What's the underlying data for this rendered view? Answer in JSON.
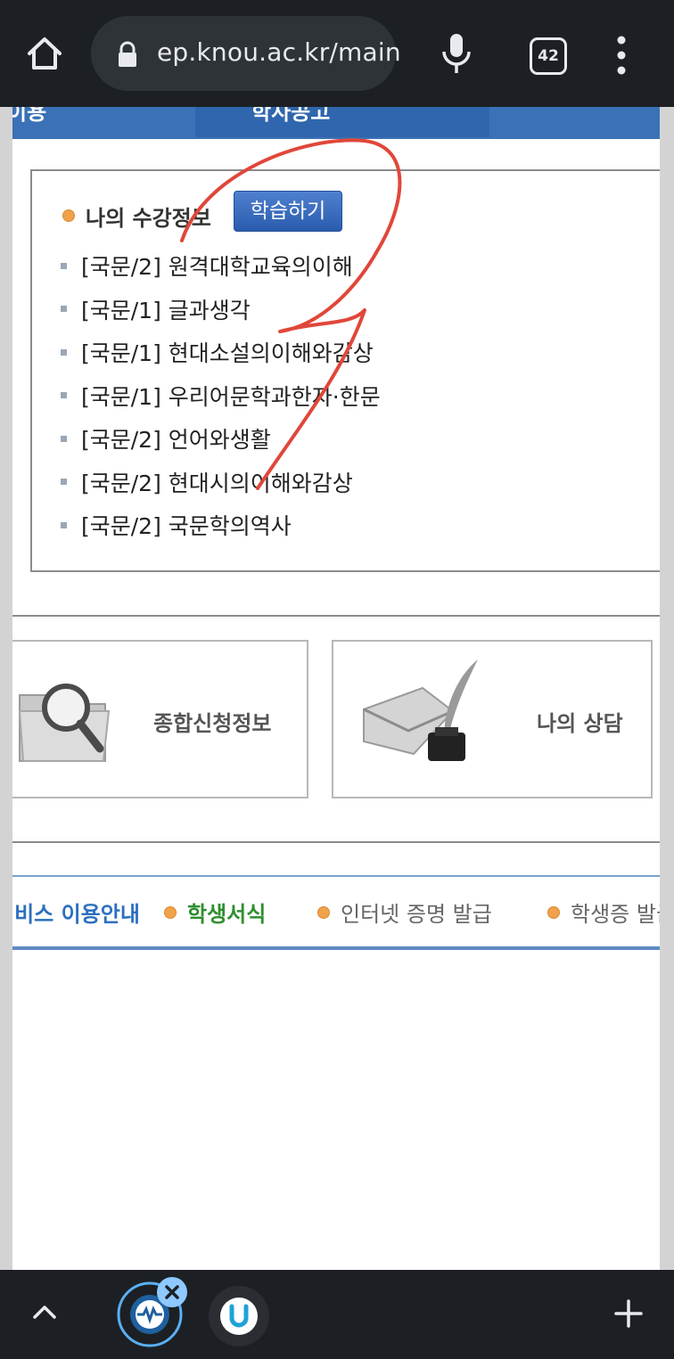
{
  "browser": {
    "url": "ep.knou.ac.kr/main",
    "tab_count": "42",
    "icons": [
      "home-icon",
      "lock-icon",
      "mic-icon",
      "tab-switcher-icon",
      "more-vert-icon"
    ]
  },
  "topnav": {
    "left_label": "이용",
    "active_label": "학사공고"
  },
  "course_section": {
    "title": "나의 수강정보",
    "study_button": "학습하기",
    "courses": [
      "[국문/2] 원격대학교육의이해",
      "[국문/1] 글과생각",
      "[국문/1] 현대소설의이해와감상",
      "[국문/1] 우리어문학과한자·한문",
      "[국문/2] 언어와생활",
      "[국문/2] 현대시의이해와감상",
      "[국문/2] 국문학의역사"
    ]
  },
  "quick_menu": {
    "apply_info": "종합신청정보",
    "my_counsel": "나의 상담"
  },
  "links": {
    "service_guide": "서비스 이용안내",
    "student_forms": "학생서식",
    "certificate": "인터넷 증명 발급",
    "student_id": "학생증 발급"
  },
  "bottombar": {
    "icons": [
      "chevron-up-icon",
      "active-tab-icon",
      "close-icon",
      "u-app-icon",
      "plus-icon"
    ]
  },
  "colors": {
    "browser_bar": "#1c2024",
    "nav_blue": "#3b71b6",
    "button_blue": "#2a5cae",
    "bullet_orange": "#f0a24a",
    "link_blue": "#2c6fc0",
    "link_green": "#2f8f2f",
    "annotation_red": "#e0473a"
  }
}
